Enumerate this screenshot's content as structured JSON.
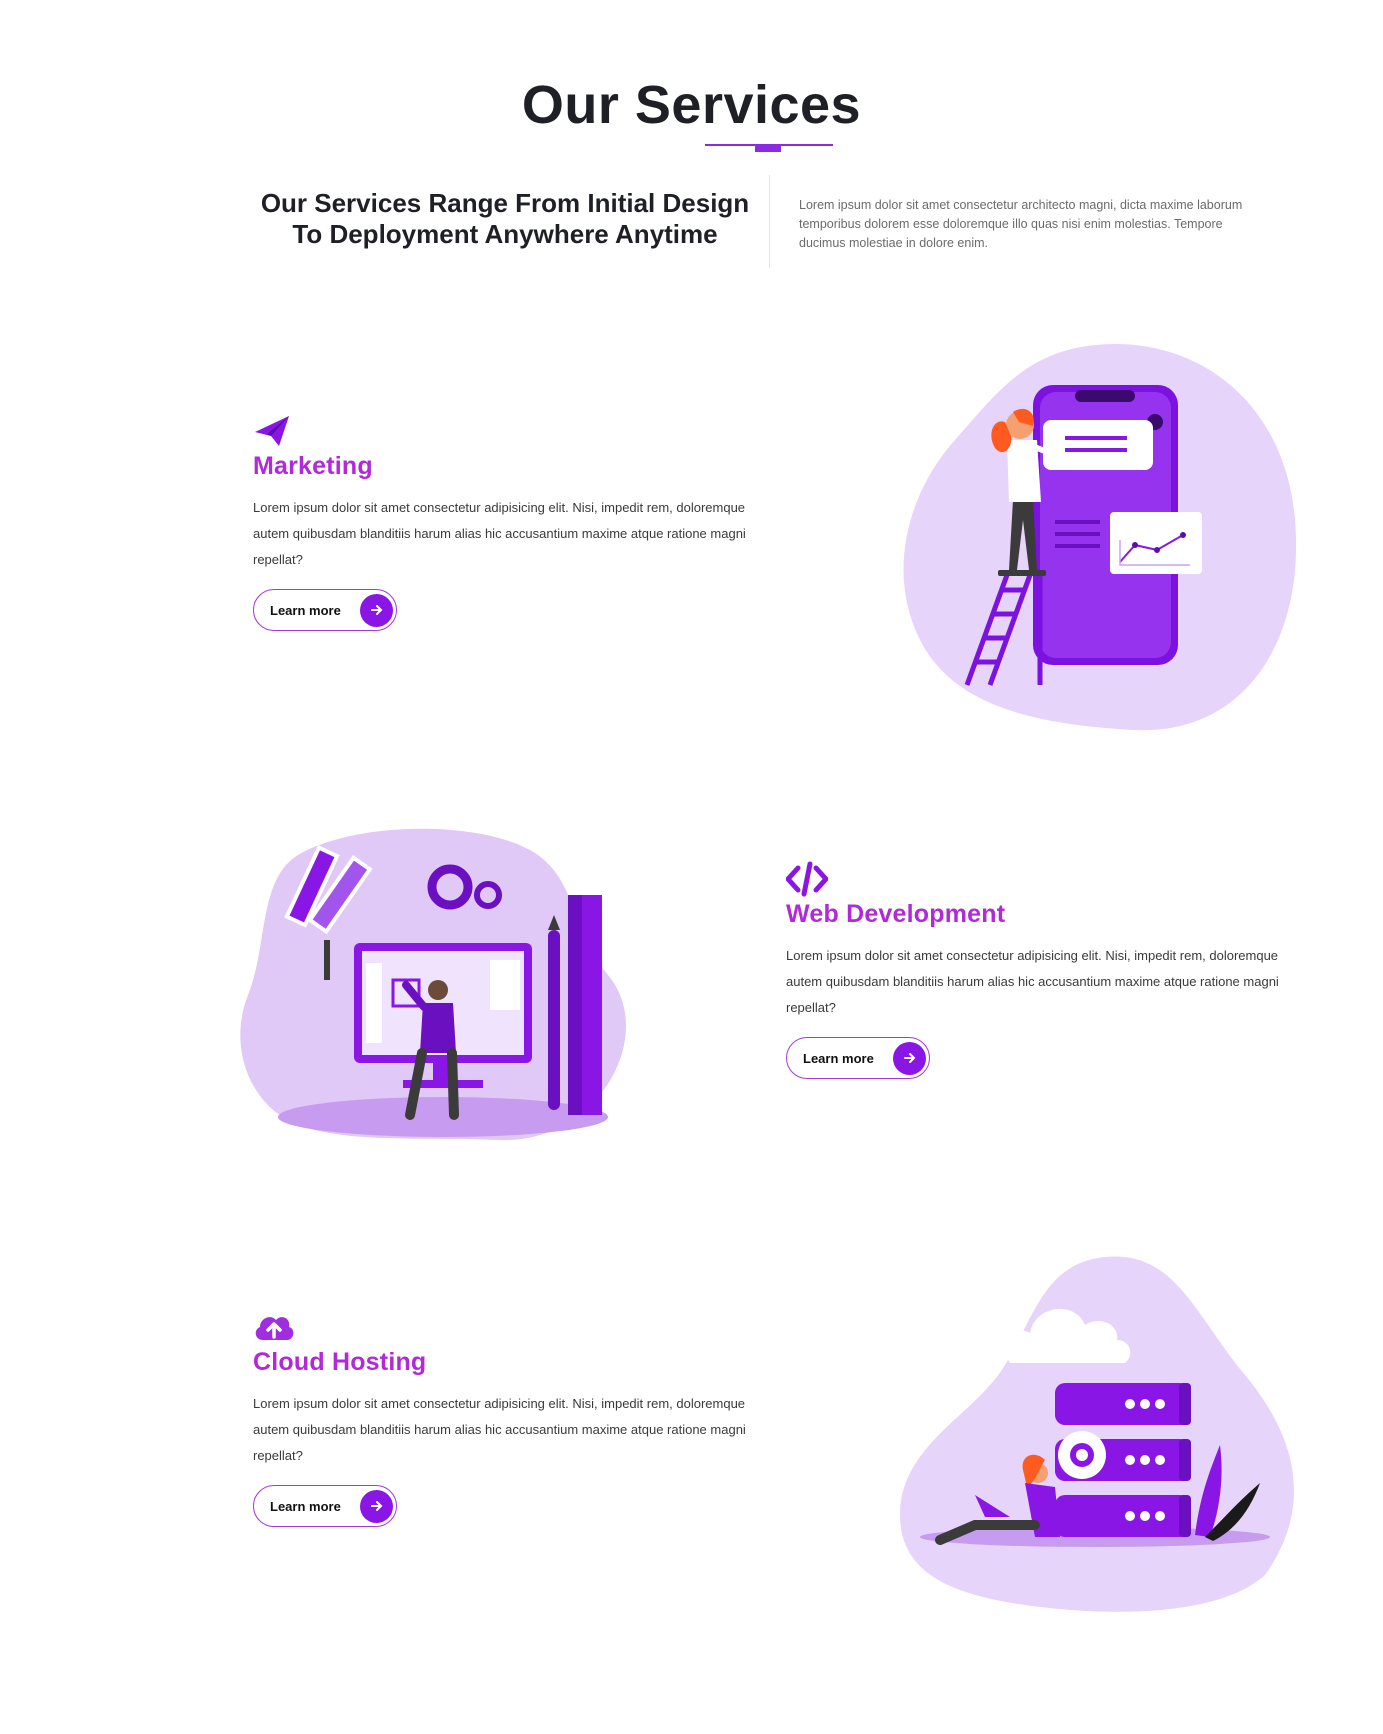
{
  "header": {
    "title": "Our Services",
    "intro_heading_line1": "Our Services Range From Initial Design",
    "intro_heading_line2": "To Deployment Anywhere Anytime",
    "intro_text": "Lorem ipsum dolor sit amet consectetur architecto magni, dicta maxime laborum temporibus dolorem esse doloremque illo quas nisi enim molestias. Tempore ducimus molestiae in dolore enim."
  },
  "services": [
    {
      "icon": "paper-plane-icon",
      "title": "Marketing",
      "description": "Lorem ipsum dolor sit amet consectetur adipisicing elit. Nisi, impedit rem, doloremque autem quibusdam blanditiis harum alias hic accusantium maxime atque ratione magni repellat?",
      "button_label": "Learn more",
      "illustration": "phone-ladder-illustration"
    },
    {
      "icon": "code-icon",
      "title": "Web Development",
      "description": "Lorem ipsum dolor sit amet consectetur adipisicing elit. Nisi, impedit rem, doloremque autem quibusdam blanditiis harum alias hic accusantium maxime atque ratione magni repellat?",
      "button_label": "Learn more",
      "illustration": "monitor-designer-illustration"
    },
    {
      "icon": "cloud-upload-icon",
      "title": "Cloud Hosting",
      "description": "Lorem ipsum dolor sit amet consectetur adipisicing elit. Nisi, impedit rem, doloremque autem quibusdam blanditiis harum alias hic accusantium maxime atque ratione magni repellat?",
      "button_label": "Learn more",
      "illustration": "server-stack-illustration"
    }
  ],
  "colors": {
    "accent": "#8a16e6",
    "title_purple": "#b129d8",
    "blob": "#e7d4fb",
    "dark_text": "#1f2026"
  }
}
